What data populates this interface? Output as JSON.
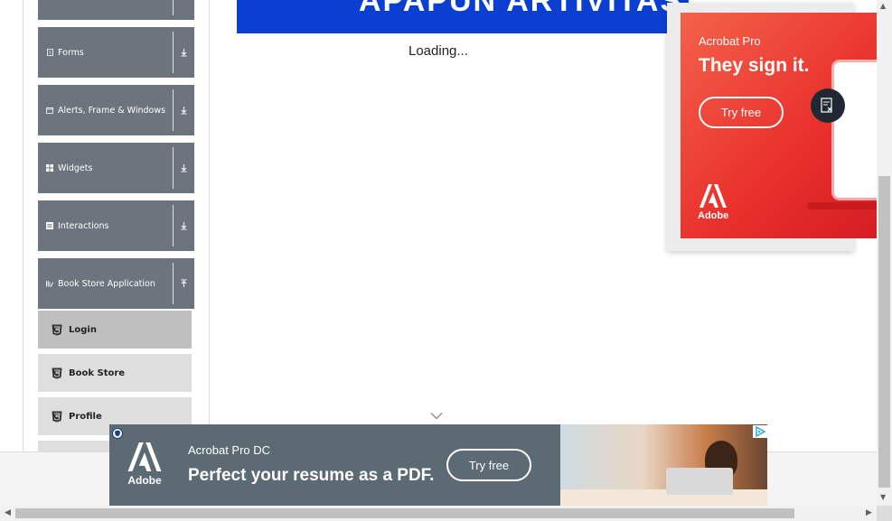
{
  "sidebar": {
    "groups": [
      {
        "label": "",
        "icon": "doc-icon"
      },
      {
        "label": "Forms",
        "icon": "doc-icon"
      },
      {
        "label": "Alerts, Frame & Windows",
        "icon": "window-icon"
      },
      {
        "label": "Widgets",
        "icon": "grid-icon"
      },
      {
        "label": "Interactions",
        "icon": "list-icon"
      },
      {
        "label": "Book Store Application",
        "icon": "books-icon"
      }
    ],
    "sub_items": [
      {
        "label": "Login",
        "icon": "html5-icon",
        "active": true
      },
      {
        "label": "Book Store",
        "icon": "html5-icon",
        "active": false
      },
      {
        "label": "Profile",
        "icon": "html5-icon",
        "active": false
      }
    ]
  },
  "main": {
    "banner_text": "APAPUN ARTIVITAS",
    "loading_text": "Loading..."
  },
  "side_ad": {
    "brand": "Acrobat Pro",
    "headline": "They sign it.",
    "button": "Try free",
    "logo_text": "Adobe",
    "bg_color": "#e9302c"
  },
  "bottom_ad": {
    "brand": "Acrobat Pro DC",
    "headline": "Perfect your resume as a PDF.",
    "button": "Try free",
    "logo_text": "Adobe",
    "bg_color": "#5b6a73"
  }
}
